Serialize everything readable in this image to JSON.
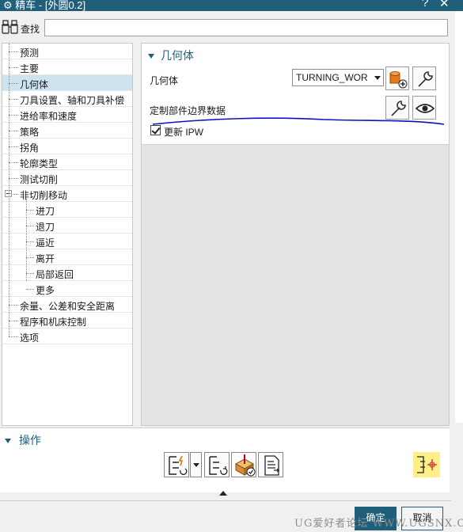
{
  "window": {
    "title": "精车 - [外圆0.2]",
    "help": "?",
    "close": "✕"
  },
  "find": {
    "label": "查找",
    "value": ""
  },
  "tree": {
    "items": [
      {
        "label": "预测",
        "level": 0
      },
      {
        "label": "主要",
        "level": 0
      },
      {
        "label": "几何体",
        "level": 0,
        "selected": true
      },
      {
        "label": "刀具设置、轴和刀具补偿",
        "level": 0
      },
      {
        "label": "进给率和速度",
        "level": 0
      },
      {
        "label": "策略",
        "level": 0
      },
      {
        "label": "拐角",
        "level": 0
      },
      {
        "label": "轮廓类型",
        "level": 0
      },
      {
        "label": "测试切削",
        "level": 0
      },
      {
        "label": "非切削移动",
        "level": 0,
        "expanded": true
      },
      {
        "label": "进刀",
        "level": 1
      },
      {
        "label": "退刀",
        "level": 1
      },
      {
        "label": "逼近",
        "level": 1
      },
      {
        "label": "离开",
        "level": 1
      },
      {
        "label": "局部返回",
        "level": 1
      },
      {
        "label": "更多",
        "level": 1
      },
      {
        "label": "余量、公差和安全距离",
        "level": 0
      },
      {
        "label": "程序和机床控制",
        "level": 0
      },
      {
        "label": "选项",
        "level": 0
      }
    ]
  },
  "geometry_group": {
    "header": "几何体",
    "geometry_label": "几何体",
    "geometry_value": "TURNING_WOR",
    "custom_boundary_label": "定制部件边界数据",
    "update_ipw_label": "更新 IPW",
    "update_ipw_checked": true
  },
  "operations": {
    "header": "操作"
  },
  "dialog": {
    "ok": "确定",
    "cancel": "取消"
  },
  "watermark": "UG爱好者论坛 WWW.UGSNX.COM",
  "colors": {
    "accent": "#1f5f7a",
    "selected_row": "#cde3ef",
    "annotation": "#1010c0"
  }
}
